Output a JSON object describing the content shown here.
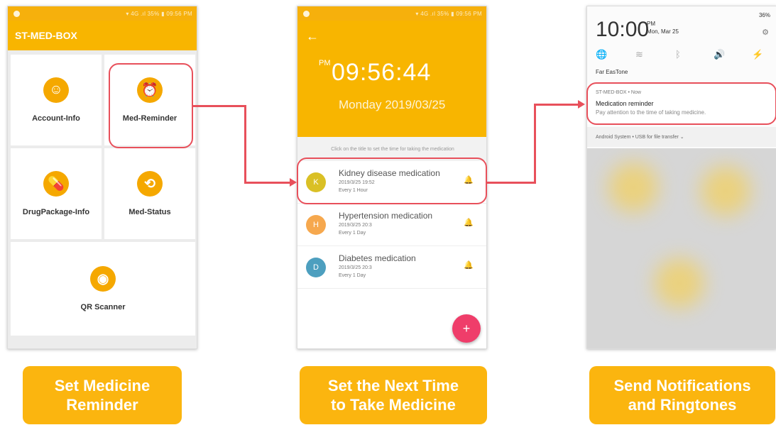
{
  "phone1": {
    "status": "▾ 4G .ıl 35% ▮ 09:56 PM",
    "app_title": "ST-MED-BOX",
    "tiles": [
      {
        "label": "Account-Info",
        "icon": "☺"
      },
      {
        "label": "Med-Reminder",
        "icon": "⏰"
      },
      {
        "label": "DrugPackage-Info",
        "icon": "💊"
      },
      {
        "label": "Med-Status",
        "icon": "⟲"
      },
      {
        "label": "QR Scanner",
        "icon": "◉"
      }
    ]
  },
  "phone2": {
    "status": "▾ 4G .ıl 35% ▮ 09:56 PM",
    "ampm": "PM",
    "time": "09:56:44",
    "date": "Monday 2019/03/25",
    "hint": "Click on the title to set the time for taking the medication",
    "meds": [
      {
        "initial": "K",
        "name": "Kidney disease medication",
        "time": "2019/3/25 19:52",
        "freq": "Every 1 Hour",
        "color": "#d4b600"
      },
      {
        "initial": "H",
        "name": "Hypertension medication",
        "time": "2019/3/25 20:3",
        "freq": "Every 1 Day",
        "color": "#f59a30"
      },
      {
        "initial": "D",
        "name": "Diabetes medication",
        "time": "2019/3/25 20:3",
        "freq": "Every 1 Day",
        "color": "#2f8fb5"
      }
    ],
    "fab": "+"
  },
  "phone3": {
    "battery": "36%",
    "clock": "10:00",
    "ampm": "PM",
    "date": "Mon, Mar 25",
    "carrier": "Far EasTone",
    "notification": {
      "source": "ST-MED-BOX • Now",
      "title": "Medication reminder",
      "body": "Pay attention to the time of taking medicine."
    },
    "system": "Android System • USB for file transfer ⌄"
  },
  "captions": [
    {
      "line1": "Set Medicine",
      "line2": "Reminder"
    },
    {
      "line1": "Set the Next Time",
      "line2": "to Take Medicine"
    },
    {
      "line1": "Send Notifications",
      "line2": "and Ringtones"
    }
  ],
  "colors": {
    "accent": "#f8b500",
    "highlight": "#e8505b",
    "fab": "#ef3d6a"
  }
}
